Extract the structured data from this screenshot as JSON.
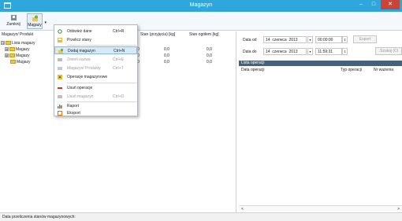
{
  "window": {
    "title": "Magazyn",
    "controls": {
      "min": "–",
      "max": "□",
      "close": "✕"
    }
  },
  "ribbon": {
    "close_label": "Zamknij",
    "magazyn_label": "Magazy",
    "caret": "▾"
  },
  "left": {
    "columns": {
      "path": "Magazyn/ Produkt",
      "in": "Stan (przyjęcia) [kg]",
      "total": "Stan ogółem [kg]"
    },
    "tree": [
      {
        "expander": "⊟",
        "label": "Lista magazy"
      },
      {
        "expander": "⊞",
        "label": "Magazy"
      },
      {
        "expander": "⊞",
        "label": "Magazy"
      },
      {
        "expander": "",
        "label": "Magazy"
      }
    ],
    "values": [
      {
        "in": "0,0",
        "total": "0,0"
      },
      {
        "in": "0,0",
        "total": "0,0"
      },
      {
        "in": "0,0",
        "total": "0,0"
      }
    ],
    "fragment": "]",
    "small_zeros": [
      "0",
      "0",
      "0"
    ]
  },
  "menu": {
    "items": [
      {
        "label": "Odśwież dane",
        "key": "Ctrl+R",
        "enabled": true,
        "icon": "refresh-icon"
      },
      {
        "label": "Przelicz stany",
        "key": "",
        "enabled": true,
        "icon": "calculate-icon"
      },
      {
        "label": "Dodaj magazyn",
        "key": "Ctrl+N",
        "enabled": true,
        "icon": "add-warehouse-icon",
        "selected": true
      },
      {
        "label": "Zmień nazwę",
        "key": "Ctrl+E",
        "enabled": false,
        "icon": "rename-icon"
      },
      {
        "label": "Magazyn/ Produkty",
        "key": "Ctrl+T",
        "enabled": false,
        "icon": "warehouse-products-icon"
      },
      {
        "label": "Operacje magazynowe",
        "key": "",
        "enabled": true,
        "icon": "operations-icon"
      },
      {
        "label": "Usuń operacje",
        "key": "",
        "enabled": true,
        "icon": "delete-operations-icon"
      },
      {
        "label": "Usuń magazyn",
        "key": "Ctrl+D",
        "enabled": false,
        "icon": "delete-warehouse-icon"
      },
      {
        "label": "Raport",
        "key": "",
        "enabled": true,
        "icon": "report-icon"
      },
      {
        "label": "Eksport",
        "key": "",
        "enabled": true,
        "icon": "export-icon"
      }
    ]
  },
  "right": {
    "from": {
      "label": "Data od",
      "day": "14",
      "month": "czerwca",
      "year": "2013",
      "time": "00:00:00"
    },
    "to": {
      "label": "Data do",
      "day": "14",
      "month": "czerwca",
      "year": "2013",
      "time": "11:59:31"
    },
    "export_label": "Export",
    "search_label": "Szukaj (Ct",
    "list_title": "Lista operacji",
    "list_columns": {
      "date": "Data operacji",
      "type": "Typ operacji",
      "weighing": "Nr ważenia"
    },
    "scroll_left": "<",
    "scroll_right": ">"
  },
  "status": {
    "text": "Data przeliczenia stanów magazynowych:"
  },
  "colors": {
    "titlebar": "#2fa7dc",
    "close": "#c7463b",
    "list_header": "#43627d"
  }
}
